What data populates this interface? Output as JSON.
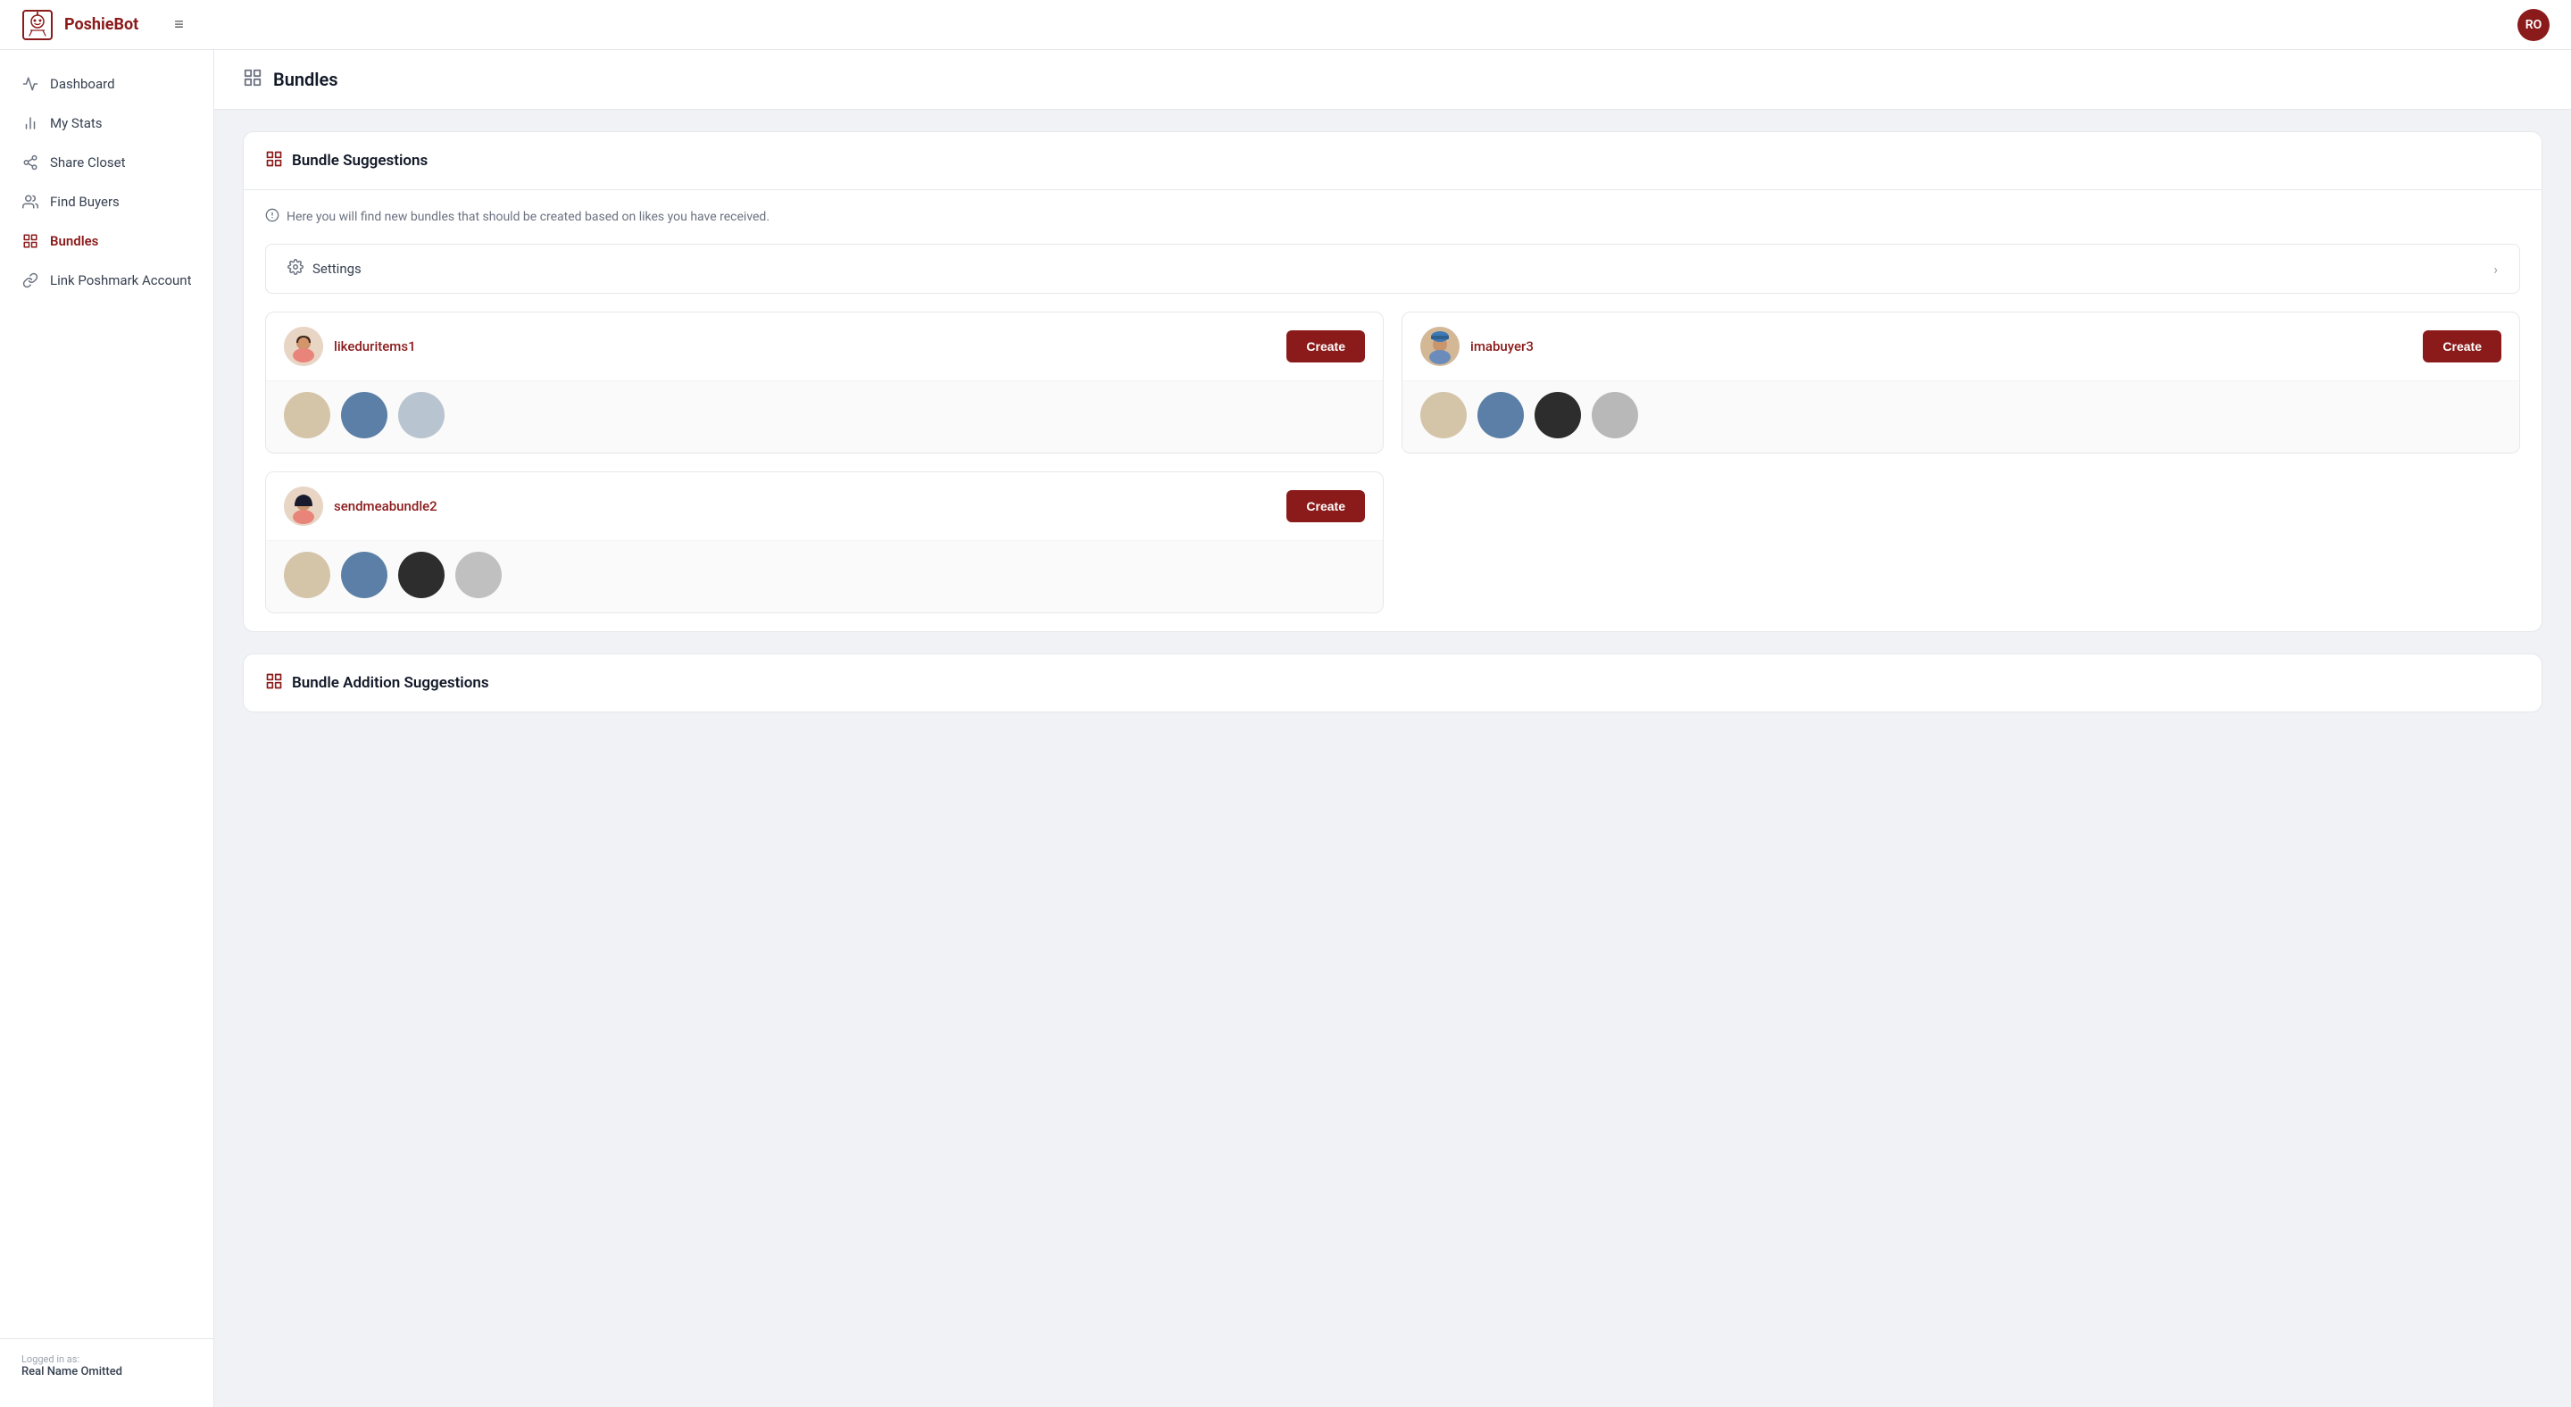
{
  "app": {
    "name": "PoshieBot",
    "user_initials": "RO"
  },
  "topnav": {
    "hamburger_label": "≡"
  },
  "sidebar": {
    "items": [
      {
        "id": "dashboard",
        "label": "Dashboard",
        "icon": "activity-icon",
        "active": false
      },
      {
        "id": "my-stats",
        "label": "My Stats",
        "icon": "bar-chart-icon",
        "active": false
      },
      {
        "id": "share-closet",
        "label": "Share Closet",
        "icon": "share-icon",
        "active": false
      },
      {
        "id": "find-buyers",
        "label": "Find Buyers",
        "icon": "users-icon",
        "active": false
      },
      {
        "id": "bundles",
        "label": "Bundles",
        "icon": "bundles-icon",
        "active": true
      },
      {
        "id": "link-poshmark",
        "label": "Link Poshmark Account",
        "icon": "link-icon",
        "active": false
      }
    ],
    "footer": {
      "logged_in_label": "Logged in as:",
      "user_name": "Real Name Omitted"
    }
  },
  "page": {
    "title": "Bundles",
    "sections": [
      {
        "id": "bundle-suggestions",
        "title": "Bundle Suggestions",
        "info_text": "Here you will find new bundles that should be created based on likes you have received.",
        "settings_label": "Settings",
        "bundles": [
          {
            "id": "bundle-1",
            "username": "likeduritems1",
            "create_label": "Create",
            "items": [
              "item-beige-1",
              "item-jeans-1",
              "item-floral-1"
            ]
          },
          {
            "id": "bundle-2",
            "username": "imabuyer3",
            "create_label": "Create",
            "items": [
              "item-beige-2",
              "item-jeans-2",
              "item-black-tee-1",
              "item-gray-1"
            ]
          },
          {
            "id": "bundle-3",
            "username": "sendmeabundle2",
            "create_label": "Create",
            "items": [
              "item-beige-3",
              "item-jeans-3",
              "item-black-tee-2",
              "item-gray-2"
            ]
          }
        ]
      },
      {
        "id": "bundle-addition-suggestions",
        "title": "Bundle Addition Suggestions"
      }
    ]
  }
}
